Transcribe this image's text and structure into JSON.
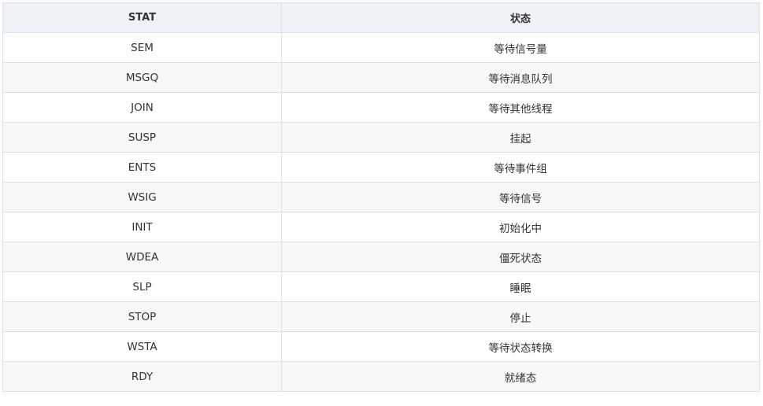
{
  "table": {
    "headers": [
      "STAT",
      "状态"
    ],
    "rows": [
      [
        "SEM",
        "等待信号量"
      ],
      [
        "MSGQ",
        "等待消息队列"
      ],
      [
        "JOIN",
        "等待其他线程"
      ],
      [
        "SUSP",
        "挂起"
      ],
      [
        "ENTS",
        "等待事件组"
      ],
      [
        "WSIG",
        "等待信号"
      ],
      [
        "INIT",
        "初始化中"
      ],
      [
        "WDEA",
        "僵死状态"
      ],
      [
        "SLP",
        "睡眠"
      ],
      [
        "STOP",
        "停止"
      ],
      [
        "WSTA",
        "等待状态转换"
      ],
      [
        "RDY",
        "就绪态"
      ]
    ]
  }
}
